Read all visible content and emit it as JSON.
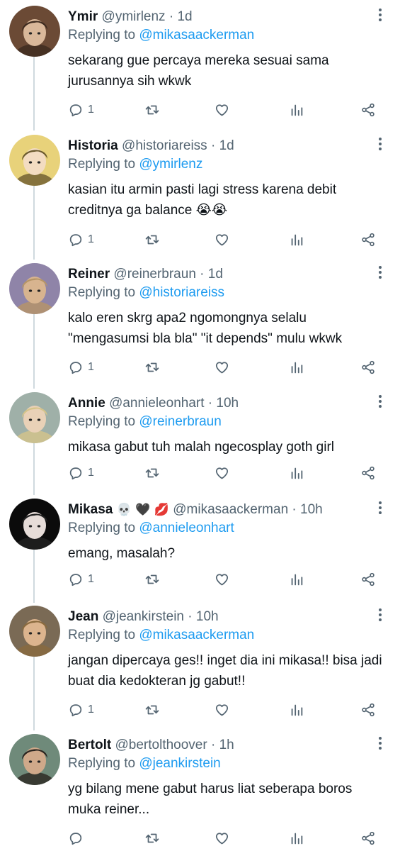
{
  "tweets": [
    {
      "name": "Ymir",
      "handle": "@ymirlenz",
      "time": "1d",
      "replying_label": "Replying to",
      "replying_to": "@mikasaackerman",
      "text": "sekarang gue percaya mereka sesuai sama jurusannya sih wkwk",
      "replies": "1",
      "colors": [
        "#6b4a35",
        "#d9b89a",
        "#3d2b1f"
      ]
    },
    {
      "name": "Historia",
      "handle": "@historiareiss",
      "time": "1d",
      "replying_label": "Replying to",
      "replying_to": "@ymirlenz",
      "text": "kasian itu armin pasti lagi stress karena debit creditnya ga balance 😭😭",
      "replies": "1",
      "colors": [
        "#e8d27a",
        "#f3dcc2",
        "#6b5a2e"
      ]
    },
    {
      "name": "Reiner",
      "handle": "@reinerbraun",
      "time": "1d",
      "replying_label": "Replying to",
      "replying_to": "@historiareiss",
      "text": "kalo eren skrg apa2 ngomongnya selalu \"mengasumsi bla bla\" \"it depends\" mulu wkwk",
      "replies": "1",
      "colors": [
        "#8f84a8",
        "#d8b48f",
        "#b69567"
      ]
    },
    {
      "name": "Annie",
      "handle": "@annieleonhart",
      "time": "10h",
      "replying_label": "Replying to",
      "replying_to": "@reinerbraun",
      "text": "mikasa gabut tuh malah ngecosplay goth girl",
      "replies": "1",
      "colors": [
        "#9fb0a8",
        "#e9d1b7",
        "#d5c48a"
      ]
    },
    {
      "name": "Mikasa",
      "name_emoji": "💀 🖤 💋",
      "handle": "@mikasaackerman",
      "time": "10h",
      "replying_label": "Replying to",
      "replying_to": "@annieleonhart",
      "text": "emang, masalah?",
      "replies": "1",
      "colors": [
        "#0b0b0b",
        "#e6dcd8",
        "#222222"
      ]
    },
    {
      "name": "Jean",
      "handle": "@jeankirstein",
      "time": "10h",
      "replying_label": "Replying to",
      "replying_to": "@mikasaackerman",
      "text": "jangan dipercaya ges!! inget dia ini mikasa!! bisa jadi buat dia kedokteran jg gabut!!",
      "replies": "1",
      "colors": [
        "#7a6a55",
        "#dcb48e",
        "#8a6a3e"
      ]
    },
    {
      "name": "Bertolt",
      "handle": "@bertolthoover",
      "time": "1h",
      "replying_label": "Replying to",
      "replying_to": "@jeankirstein",
      "text": "yg bilang mene gabut harus liat seberapa boros muka reiner...",
      "replies": "",
      "colors": [
        "#6f8a7a",
        "#cfa98a",
        "#2a2520"
      ]
    }
  ]
}
